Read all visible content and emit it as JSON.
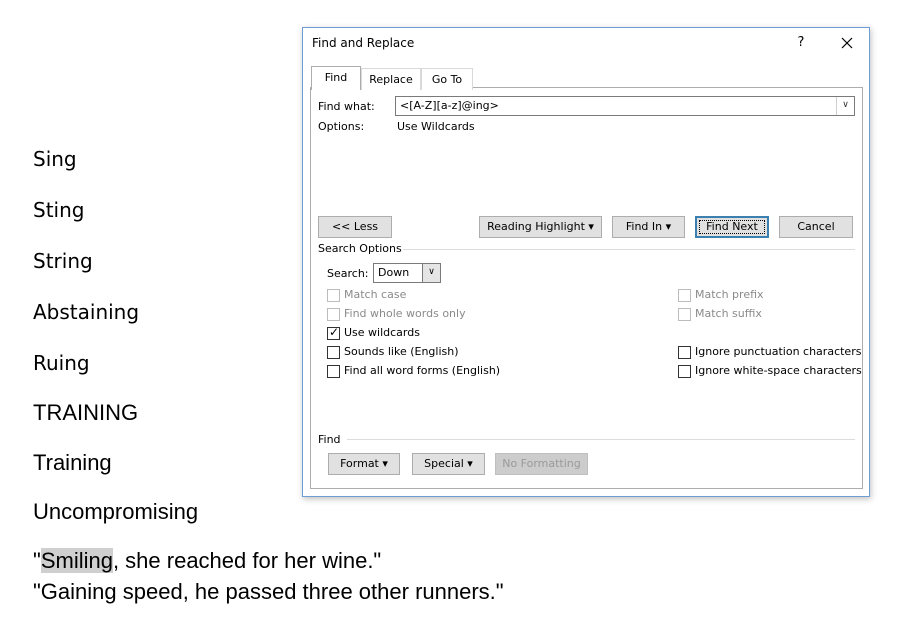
{
  "document": {
    "lines": [
      "Sing",
      "Sting",
      "String",
      "Abstaining",
      "Ruing",
      "TRAINING",
      "Training",
      "Uncompromising"
    ],
    "sentence1_prefix": "\"",
    "sentence1_highlight": "Smiling",
    "sentence1_rest": ", she reached for her wine.\"",
    "sentence2": "\"Gaining speed, he passed three other runners.\""
  },
  "dialog": {
    "title": "Find and Replace",
    "help_label": "?",
    "tabs": [
      "Find",
      "Replace",
      "Go To"
    ],
    "find_what_label": "Find what:",
    "find_what_value": "<[A-Z][a-z]@ing>",
    "options_label": "Options:",
    "options_value": "Use Wildcards",
    "buttons": {
      "less": "<< Less",
      "reading_highlight": "Reading Highlight ▾",
      "find_in": "Find In ▾",
      "find_next": "Find Next",
      "cancel": "Cancel"
    },
    "search_options_title": "Search Options",
    "search_label": "Search:",
    "search_value": "Down",
    "checkboxes_left": [
      {
        "label": "Match case",
        "checked": false,
        "disabled": true
      },
      {
        "label": "Find whole words only",
        "checked": false,
        "disabled": true
      },
      {
        "label": "Use wildcards",
        "checked": true,
        "disabled": false
      },
      {
        "label": "Sounds like (English)",
        "checked": false,
        "disabled": false
      },
      {
        "label": "Find all word forms (English)",
        "checked": false,
        "disabled": false
      }
    ],
    "checkboxes_right": [
      {
        "label": "Match prefix",
        "checked": false,
        "disabled": true
      },
      {
        "label": "Match suffix",
        "checked": false,
        "disabled": true
      },
      {
        "label": "Ignore punctuation characters",
        "checked": false,
        "disabled": false
      },
      {
        "label": "Ignore white-space characters",
        "checked": false,
        "disabled": false
      }
    ],
    "find_section_title": "Find",
    "format_button": "Format ▾",
    "special_button": "Special ▾",
    "no_formatting_button": "No Formatting"
  },
  "colors": {
    "dialog_border": "#6e9dd3",
    "default_button_border": "#3c7fb1",
    "highlight": "#cfcfcf"
  }
}
